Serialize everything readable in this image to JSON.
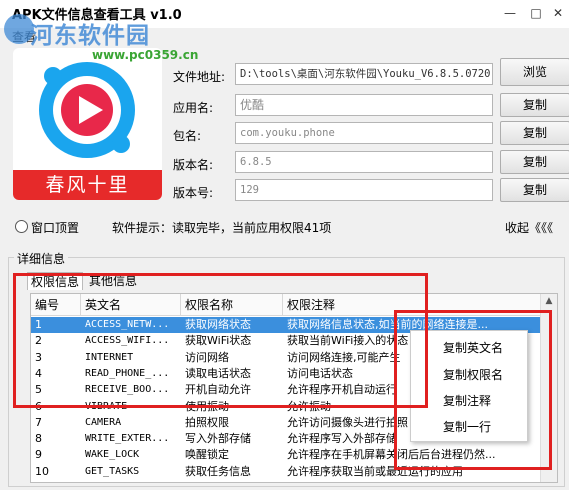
{
  "window": {
    "title": "APK文件信息查看工具 v1.0",
    "menu": "查看",
    "controls": {
      "minimize": "—",
      "maximize": "□",
      "close": "✕"
    }
  },
  "watermark": {
    "text": "河东软件园",
    "url": "www.pc0359.cn"
  },
  "app_icon": {
    "caption": "春风十里",
    "icon": "youku-play-icon",
    "color": "#1aa5ee"
  },
  "fields": {
    "path_label": "文件地址:",
    "path_value": "D:\\tools\\桌面\\河东软件园\\Youku_V6.8.5.0720",
    "browse": "浏览",
    "app_name_label": "应用名:",
    "app_name_value": "优酷",
    "package_label": "包名:",
    "package_value": "com.youku.phone",
    "version_name_label": "版本名:",
    "version_name_value": "6.8.5",
    "version_code_label": "版本号:",
    "version_code_value": "129",
    "copy": "复制"
  },
  "options": {
    "topmost": "窗口顶置",
    "hint": "软件提示：读取完毕，当前应用权限41项",
    "collapse": "收起《《《"
  },
  "details": {
    "title": "详细信息",
    "tabs": [
      "权限信息",
      "其他信息"
    ],
    "columns": [
      "编号",
      "英文名",
      "权限名称",
      "权限注释"
    ],
    "rows": [
      [
        "1",
        "ACCESS_NETW...",
        "获取网络状态",
        "获取网络信息状态,如当前的网络连接是..."
      ],
      [
        "2",
        "ACCESS_WIFI...",
        "获取WiFi状态",
        "获取当前WiFi接入的状态"
      ],
      [
        "3",
        "INTERNET",
        "访问网络",
        "访问网络连接,可能产生"
      ],
      [
        "4",
        "READ_PHONE_...",
        "读取电话状态",
        "访问电话状态"
      ],
      [
        "5",
        "RECEIVE_BOO...",
        "开机自动允许",
        "允许程序开机自动运行"
      ],
      [
        "6",
        "VIBRATE",
        "使用振动",
        "允许振动"
      ],
      [
        "7",
        "CAMERA",
        "拍照权限",
        "允许访问摄像头进行拍照"
      ],
      [
        "8",
        "WRITE_EXTER...",
        "写入外部存储",
        "允许程序写入外部存储"
      ],
      [
        "9",
        "WAKE_LOCK",
        "唤醒锁定",
        "允许程序在手机屏幕关闭后后台进程仍然..."
      ],
      [
        "10",
        "GET_TASKS",
        "获取任务信息",
        "允许程序获取当前或最近运行的应用"
      ]
    ]
  },
  "context_menu": [
    "复制英文名",
    "复制权限名",
    "复制注释",
    "复制一行"
  ],
  "highlight_color": "#e02020"
}
